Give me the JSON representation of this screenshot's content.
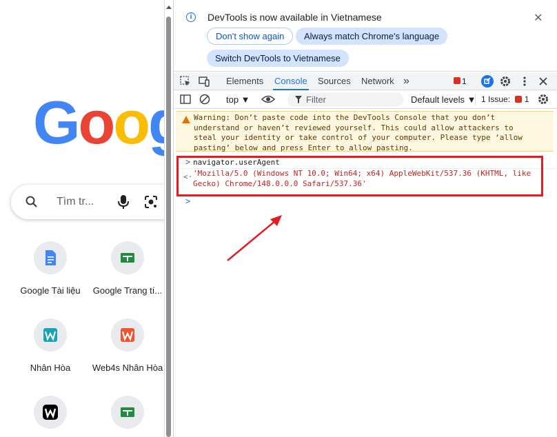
{
  "newtab": {
    "logo_letters": [
      "G",
      "o",
      "o",
      "g"
    ],
    "search_placeholder": "Tìm tr...",
    "shortcuts": [
      {
        "label": "Google Tài liệu",
        "icon": "google-docs-icon",
        "color": "#4285f4"
      },
      {
        "label": "Google Trang tí...",
        "icon": "google-sheets-icon",
        "color": "#1e8e3e"
      },
      {
        "label": "Nhân Hòa",
        "icon": "nhanhoa-icon",
        "color": "#1aa3b8"
      },
      {
        "label": "Web4s Nhân Hòa",
        "icon": "web4s-icon",
        "color": "#f0542c"
      },
      {
        "label": "",
        "icon": "w-logo-icon",
        "color": "#000000"
      },
      {
        "label": "",
        "icon": "google-sheets-icon",
        "color": "#1e8e3e"
      }
    ]
  },
  "devtools": {
    "infobar": {
      "message": "DevTools is now available in Vietnamese",
      "dont_show": "Don't show again",
      "always_match": "Always match Chrome's language",
      "switch": "Switch DevTools to Vietnamese",
      "close": "✕"
    },
    "tabs": {
      "elements": "Elements",
      "console": "Console",
      "sources": "Sources",
      "network": "Network",
      "more": "»",
      "error_count": "1"
    },
    "toolbar": {
      "context": "top ▼",
      "filter_placeholder": "Filter",
      "levels": "Default levels ▼",
      "issues_label": "1 Issue:",
      "issues_count": "1"
    },
    "console": {
      "warning": "Warning: Don’t paste code into the DevTools Console that you don’t\nunderstand or haven’t reviewed yourself. This could allow attackers to\nsteal your identity or take control of your computer. Please type ‘allow\npasting’ below and press Enter to allow pasting.",
      "input_prompt": ">",
      "input": "navigator.userAgent",
      "output_prompt": "<·",
      "output": "'Mozilla/5.0 (Windows NT 10.0; Win64; x64) AppleWebKit/537.36 (KHTML, like\nGecko) Chrome/148.0.0.0 Safari/537.36'",
      "empty_prompt": ">"
    }
  },
  "colors": {
    "google_blue": "#4285f4",
    "google_red": "#ea4335",
    "google_yellow": "#fbbc05",
    "accent": "#1a73e8",
    "highlight_red": "#e31b23"
  }
}
